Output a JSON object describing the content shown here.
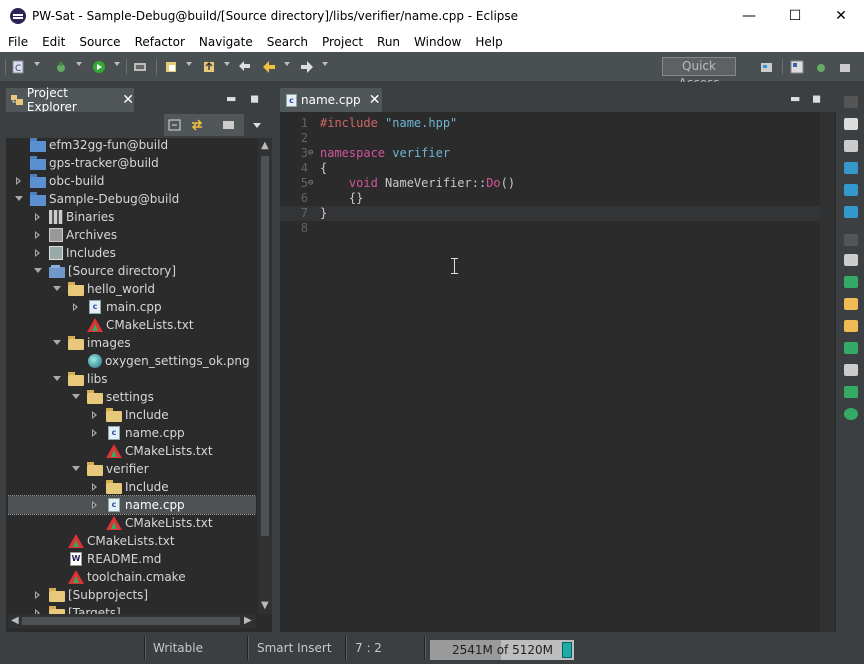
{
  "window": {
    "title": "PW-Sat - Sample-Debug@build/[Source directory]/libs/verifier/name.cpp - Eclipse",
    "minimize_glyph": "—",
    "maximize_glyph": "☐",
    "close_glyph": "✕"
  },
  "menu": [
    "File",
    "Edit",
    "Source",
    "Refactor",
    "Navigate",
    "Search",
    "Project",
    "Run",
    "Window",
    "Help"
  ],
  "toolbar": {
    "quick_access": "Quick Access",
    "icons": [
      "new-icon",
      "debug-icon",
      "run-icon",
      "build-icon",
      "open-type-icon",
      "open-resource-icon",
      "prev-edit-icon",
      "back-icon",
      "forward-icon",
      "perspective-icon",
      "cpp-perspective-icon",
      "debug-perspective-icon"
    ]
  },
  "project_explorer": {
    "tab_label": "Project Explorer",
    "tree": [
      {
        "label": "efm32gg-fun@build",
        "depth": 0,
        "arrow": "",
        "icon": "project"
      },
      {
        "label": "gps-tracker@build",
        "depth": 0,
        "arrow": "",
        "icon": "project"
      },
      {
        "label": "obc-build",
        "depth": 0,
        "arrow": "r",
        "icon": "project"
      },
      {
        "label": "Sample-Debug@build",
        "depth": 0,
        "arrow": "d",
        "icon": "project"
      },
      {
        "label": "Binaries",
        "depth": 1,
        "arrow": "r",
        "icon": "bin"
      },
      {
        "label": "Archives",
        "depth": 1,
        "arrow": "r",
        "icon": "arch"
      },
      {
        "label": "Includes",
        "depth": 1,
        "arrow": "r",
        "icon": "inc"
      },
      {
        "label": "[Source directory]",
        "depth": 1,
        "arrow": "d",
        "icon": "srcdir"
      },
      {
        "label": "hello_world",
        "depth": 2,
        "arrow": "d",
        "icon": "folder"
      },
      {
        "label": "main.cpp",
        "depth": 3,
        "arrow": "r",
        "icon": "cpp"
      },
      {
        "label": "CMakeLists.txt",
        "depth": 3,
        "arrow": "",
        "icon": "cmake"
      },
      {
        "label": "images",
        "depth": 2,
        "arrow": "d",
        "icon": "folder"
      },
      {
        "label": "oxygen_settings_ok.png",
        "depth": 3,
        "arrow": "",
        "icon": "png"
      },
      {
        "label": "libs",
        "depth": 2,
        "arrow": "d",
        "icon": "folder"
      },
      {
        "label": "settings",
        "depth": 3,
        "arrow": "d",
        "icon": "folder"
      },
      {
        "label": "Include",
        "depth": 4,
        "arrow": "r",
        "icon": "folder"
      },
      {
        "label": "name.cpp",
        "depth": 4,
        "arrow": "r",
        "icon": "cpp"
      },
      {
        "label": "CMakeLists.txt",
        "depth": 4,
        "arrow": "",
        "icon": "cmake"
      },
      {
        "label": "verifier",
        "depth": 3,
        "arrow": "d",
        "icon": "folder"
      },
      {
        "label": "Include",
        "depth": 4,
        "arrow": "r",
        "icon": "folder"
      },
      {
        "label": "name.cpp",
        "depth": 4,
        "arrow": "r",
        "icon": "cpp",
        "selected": true
      },
      {
        "label": "CMakeLists.txt",
        "depth": 4,
        "arrow": "",
        "icon": "cmake"
      },
      {
        "label": "CMakeLists.txt",
        "depth": 2,
        "arrow": "",
        "icon": "cmake"
      },
      {
        "label": "README.md",
        "depth": 2,
        "arrow": "",
        "icon": "md"
      },
      {
        "label": "toolchain.cmake",
        "depth": 2,
        "arrow": "",
        "icon": "cmake"
      },
      {
        "label": "[Subprojects]",
        "depth": 1,
        "arrow": "r",
        "icon": "folder"
      },
      {
        "label": "[Targets]",
        "depth": 1,
        "arrow": "r",
        "icon": "folder"
      }
    ]
  },
  "editor": {
    "tab_label": "name.cpp",
    "lines": [
      {
        "n": "1",
        "parts": [
          [
            "kw-pre",
            "#include"
          ],
          [
            "",
            " "
          ],
          [
            "kw-str",
            "\"name.hpp\""
          ]
        ]
      },
      {
        "n": "2",
        "parts": []
      },
      {
        "n": "3",
        "fold": "⊖",
        "parts": [
          [
            "kw",
            "namespace"
          ],
          [
            "",
            " "
          ],
          [
            "kw-str",
            "verifier"
          ]
        ]
      },
      {
        "n": "4",
        "parts": [
          [
            "",
            "{"
          ]
        ]
      },
      {
        "n": "5",
        "fold": "⊖",
        "parts": [
          [
            "",
            "    "
          ],
          [
            "kw",
            "void"
          ],
          [
            "",
            " NameVerifier::"
          ],
          [
            "kw",
            "Do"
          ],
          [
            "",
            "()"
          ]
        ]
      },
      {
        "n": "6",
        "parts": [
          [
            "",
            "    {}"
          ]
        ]
      },
      {
        "n": "7",
        "parts": [
          [
            "",
            "}"
          ]
        ],
        "current": true
      },
      {
        "n": "8",
        "parts": []
      }
    ]
  },
  "status": {
    "writable": "Writable",
    "insert_mode": "Smart Insert",
    "position": "7 : 2",
    "heap": "2541M of 5120M",
    "heap_used_fraction": 0.496
  }
}
